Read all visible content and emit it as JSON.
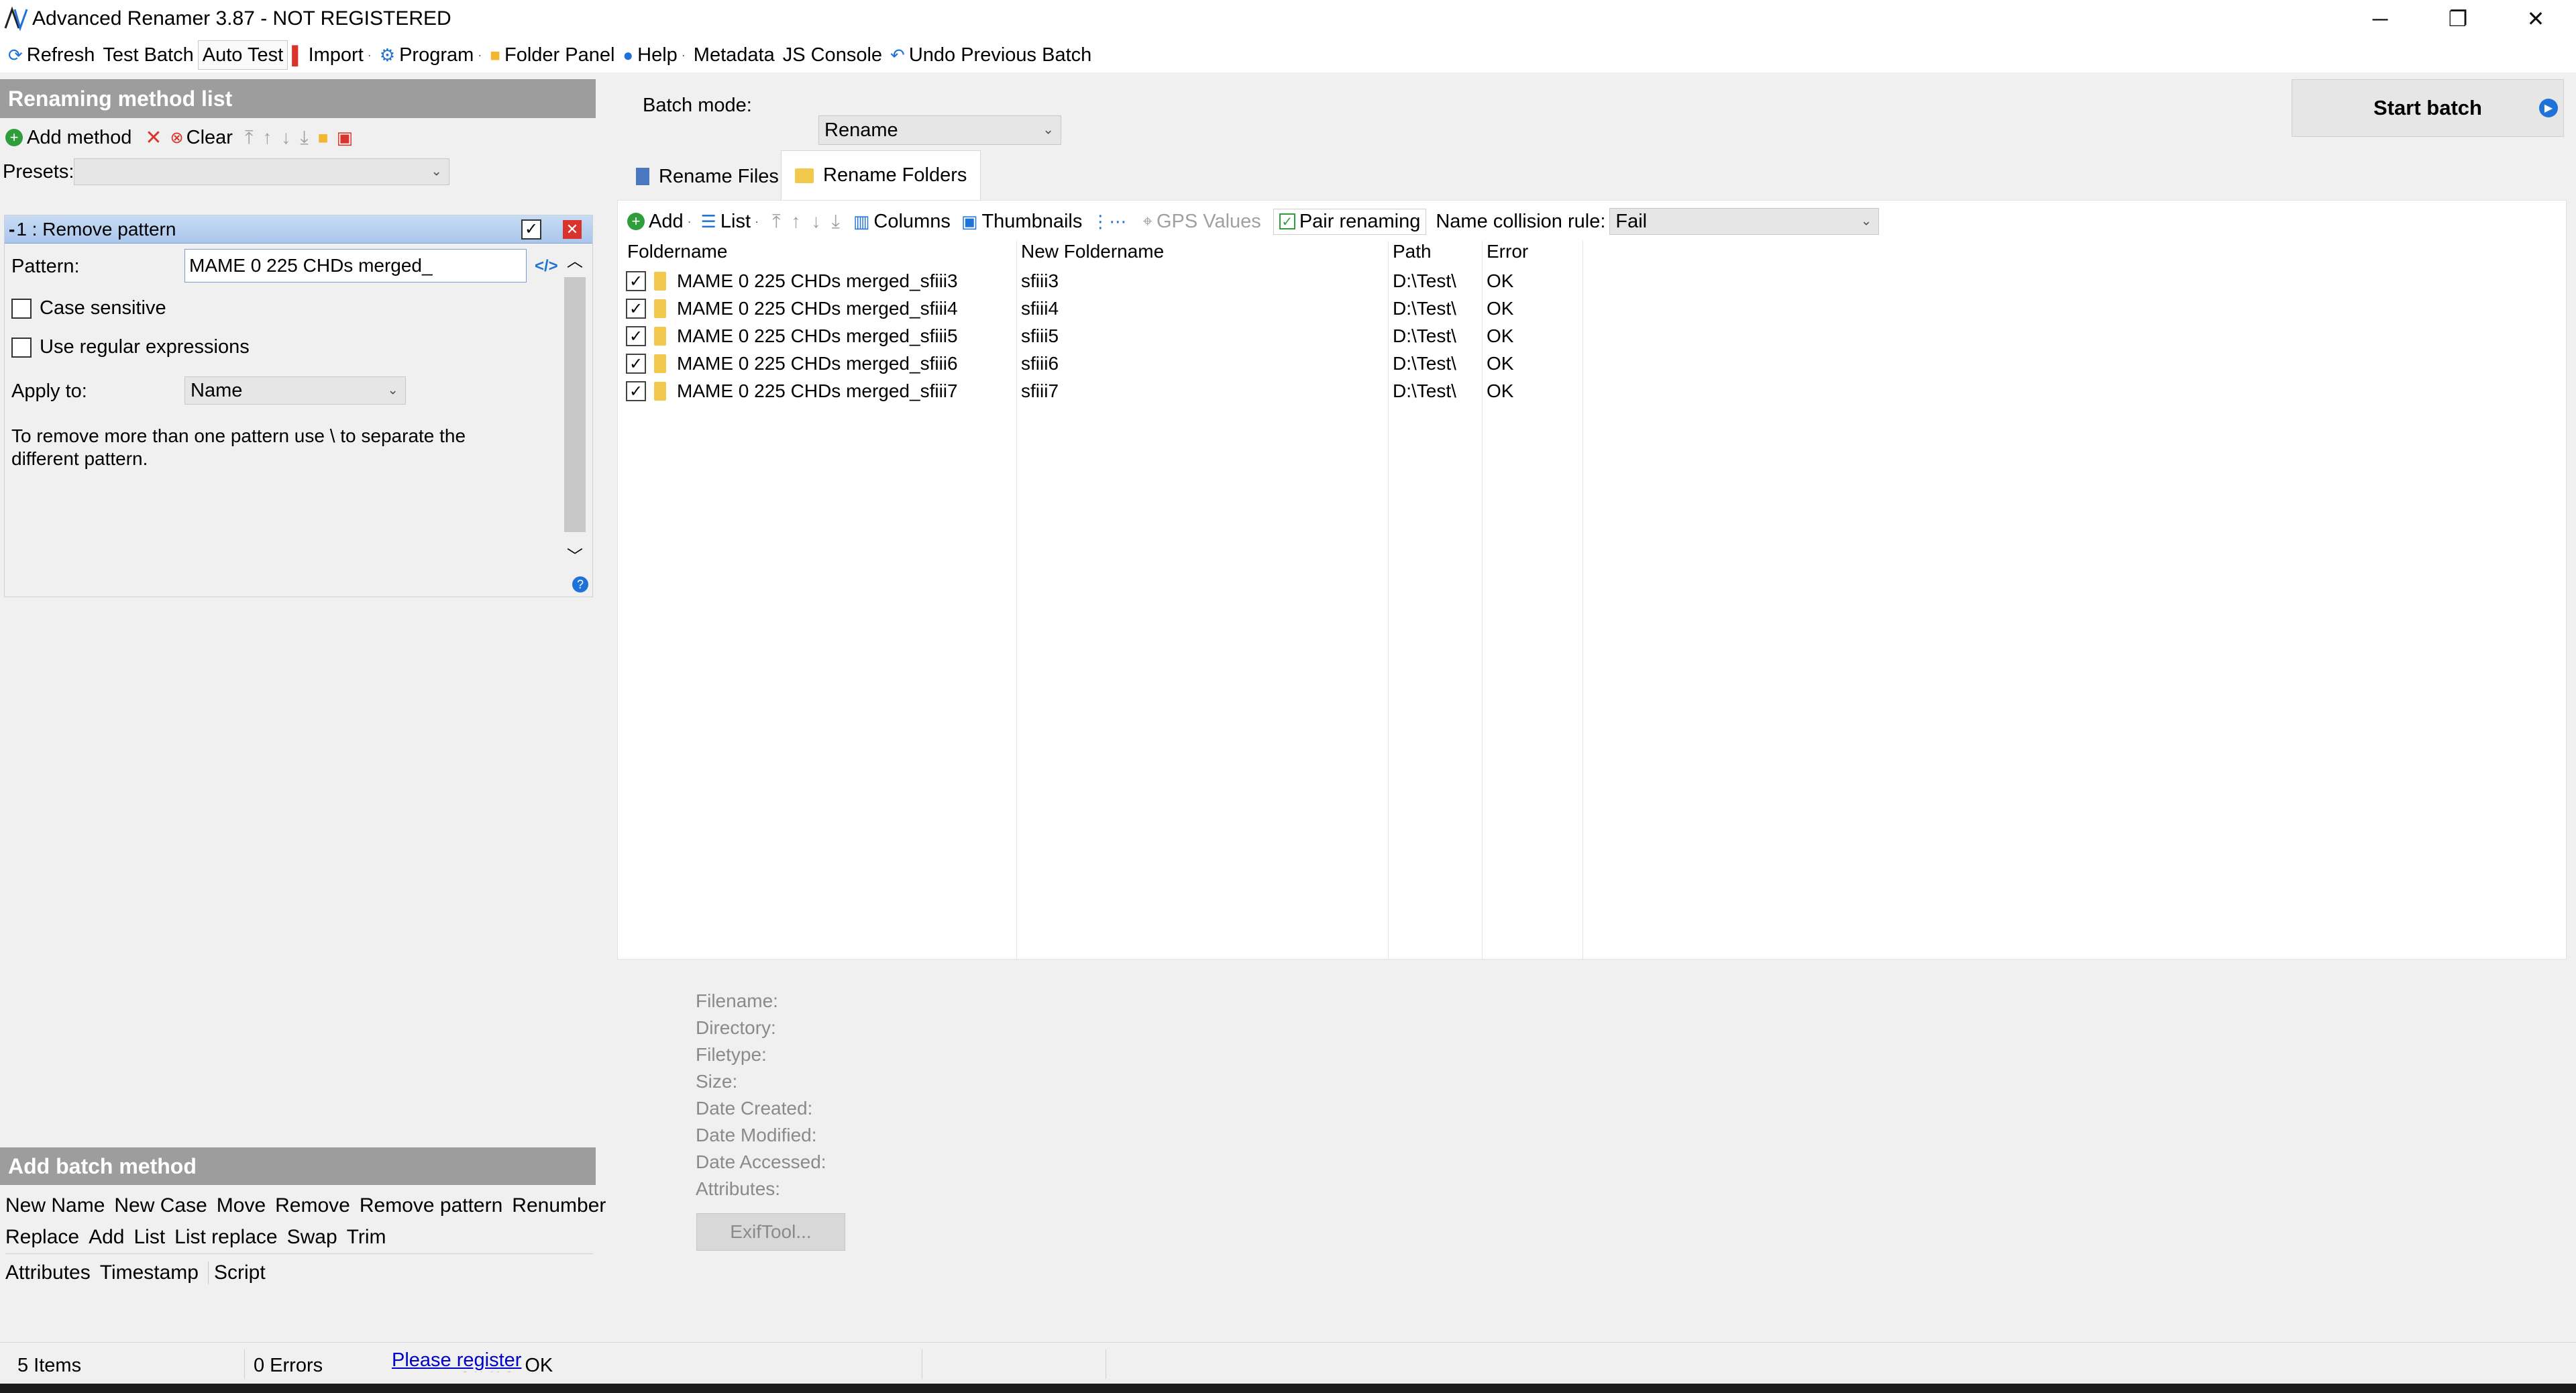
{
  "window": {
    "title": "Advanced Renamer 3.87 - NOT REGISTERED",
    "minimize_glyph": "─",
    "restore_glyph": "❐",
    "close_glyph": "✕"
  },
  "toolbar": {
    "refresh": "Refresh",
    "test_batch": "Test Batch",
    "auto_test": "Auto Test",
    "import": "Import",
    "program": "Program",
    "folder_panel": "Folder Panel",
    "help": "Help",
    "metadata": "Metadata",
    "js_console": "JS Console",
    "undo_previous_batch": "Undo Previous Batch"
  },
  "left_panel": {
    "title": "Renaming method list",
    "add_method": "Add method",
    "clear": "Clear",
    "presets_label": "Presets:",
    "presets_value": ""
  },
  "method": {
    "header": "1 : Remove pattern",
    "pattern_label": "Pattern:",
    "pattern_value": "MAME 0 225 CHDs merged_",
    "case_sensitive_label": "Case sensitive",
    "regex_label": "Use regular expressions",
    "apply_to_label": "Apply to:",
    "apply_to_value": "Name",
    "help_text": "To remove more than one pattern use \\ to separate the different pattern."
  },
  "batch": {
    "mode_label": "Batch mode:",
    "mode_value": "Rename",
    "start_label": "Start batch"
  },
  "tabs": {
    "rename_files": "Rename Files",
    "rename_folders": "Rename Folders"
  },
  "list_toolbar": {
    "add": "Add",
    "list": "List",
    "columns": "Columns",
    "thumbnails": "Thumbnails",
    "gps_values": "GPS Values",
    "pair_renaming": "Pair renaming",
    "collision_label": "Name collision rule:",
    "collision_value": "Fail"
  },
  "columns": {
    "foldername": "Foldername",
    "new_foldername": "New Foldername",
    "path": "Path",
    "error": "Error"
  },
  "rows": [
    {
      "foldername": "MAME 0 225 CHDs merged_sfiii3",
      "new_name": "sfiii3",
      "path": "D:\\Test\\",
      "error": "OK"
    },
    {
      "foldername": "MAME 0 225 CHDs merged_sfiii4",
      "new_name": "sfiii4",
      "path": "D:\\Test\\",
      "error": "OK"
    },
    {
      "foldername": "MAME 0 225 CHDs merged_sfiii5",
      "new_name": "sfiii5",
      "path": "D:\\Test\\",
      "error": "OK"
    },
    {
      "foldername": "MAME 0 225 CHDs merged_sfiii6",
      "new_name": "sfiii6",
      "path": "D:\\Test\\",
      "error": "OK"
    },
    {
      "foldername": "MAME 0 225 CHDs merged_sfiii7",
      "new_name": "sfiii7",
      "path": "D:\\Test\\",
      "error": "OK"
    }
  ],
  "info": {
    "filename": "Filename:",
    "directory": "Directory:",
    "filetype": "Filetype:",
    "size": "Size:",
    "date_created": "Date Created:",
    "date_modified": "Date Modified:",
    "date_accessed": "Date Accessed:",
    "attributes": "Attributes:",
    "exiftool": "ExifTool..."
  },
  "add_batch": {
    "title": "Add batch method",
    "row1": [
      "New Name",
      "New Case",
      "Move",
      "Remove",
      "Remove pattern",
      "Renumber"
    ],
    "row2": [
      "Replace",
      "Add",
      "List",
      "List replace",
      "Swap",
      "Trim"
    ],
    "row3": [
      "Attributes",
      "Timestamp",
      "Script"
    ]
  },
  "status": {
    "items": "5 Items",
    "errors": "0 Errors",
    "register": "Please register",
    "status_text": "Status: OK"
  },
  "colors": {
    "panel_header": "#9d9d9d",
    "accent_blue": "#1f73d8",
    "ok_green": "#2e9d3a",
    "red": "#d9332b",
    "folder": "#f2c94c"
  }
}
